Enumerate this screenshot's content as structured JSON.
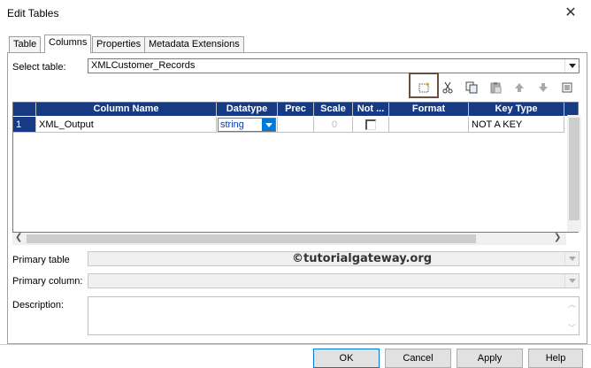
{
  "window": {
    "title": "Edit Tables",
    "close_glyph": "✕"
  },
  "tabs": [
    {
      "label": "Table"
    },
    {
      "label": "Columns"
    },
    {
      "label": "Properties"
    },
    {
      "label": "Metadata Extensions"
    }
  ],
  "select_table": {
    "label": "Select table:",
    "value": "XMLCustomer_Records"
  },
  "toolbar": {
    "icons": [
      "new-column-icon",
      "cut-icon",
      "copy-icon",
      "paste-icon",
      "move-up-icon",
      "move-down-icon",
      "import-icon"
    ]
  },
  "grid": {
    "columns": [
      "Column Name",
      "Datatype",
      "Prec",
      "Scale",
      "Not ...",
      "Format",
      "Key Type"
    ],
    "rows": [
      {
        "num": "1",
        "name": "XML_Output",
        "datatype": "string",
        "prec": "",
        "scale": "0",
        "not_null": false,
        "format": "",
        "key_type": "NOT A KEY"
      }
    ]
  },
  "fields": {
    "primary_table_label": "Primary table",
    "primary_column_label": "Primary column:",
    "description_label": "Description:"
  },
  "watermark": "©tutorialgateway.org",
  "buttons": {
    "ok": "OK",
    "cancel": "Cancel",
    "apply": "Apply",
    "help": "Help"
  },
  "colors": {
    "header_bg": "#163a84",
    "selection": "#0078d7",
    "highlight_box": "#6a4e42"
  }
}
